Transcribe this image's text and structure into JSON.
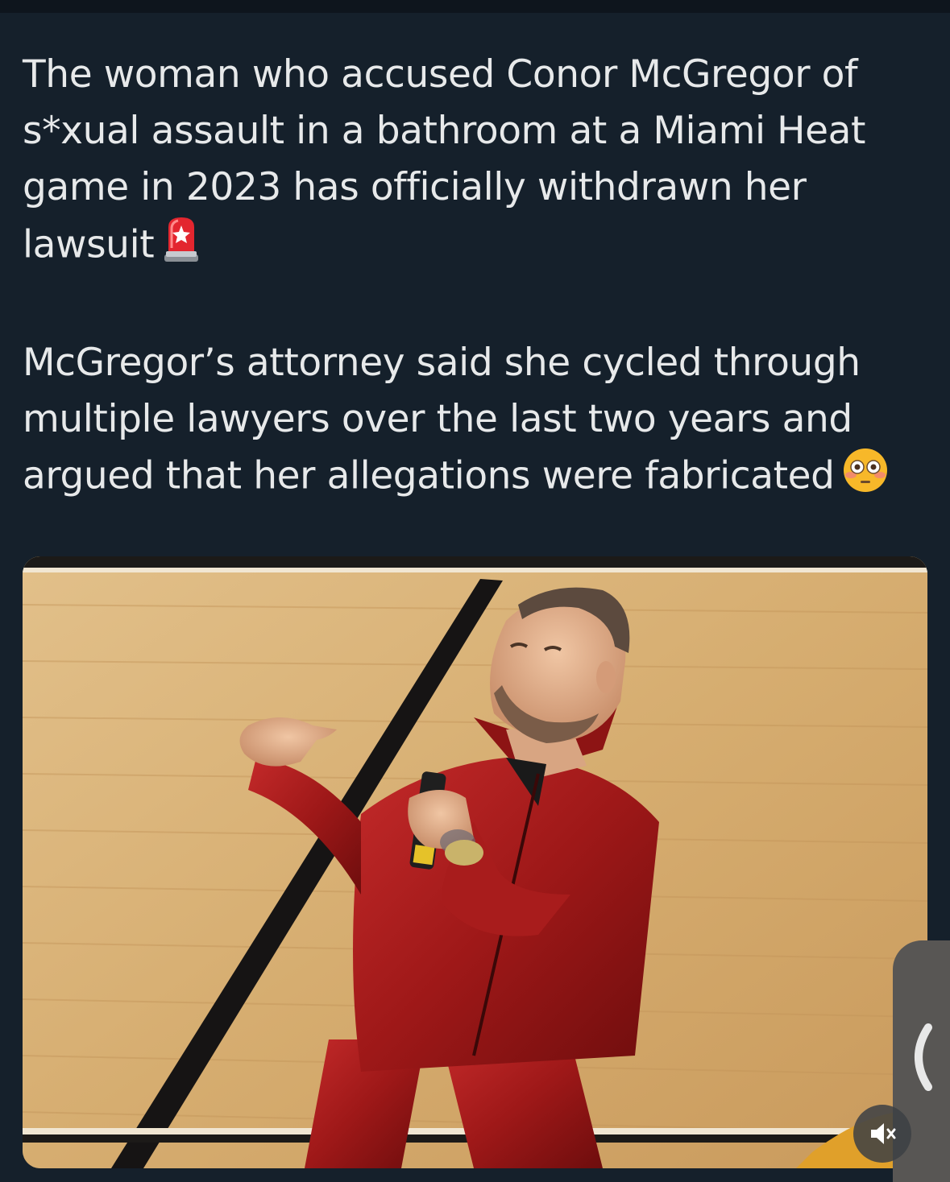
{
  "tweet": {
    "paragraph_1": "The woman who accused Conor McGregor of s*xual assault in a bathroom at a Miami Heat game in 2023 has officially withdrawn her lawsuit",
    "paragraph_1_emoji": "police-car-light-emoji",
    "paragraph_2": "McGregor’s attorney said she cycled through multiple lawyers over the last two years and argued that her allegations were fabricated",
    "paragraph_2_emoji": "flushed-face-emoji"
  },
  "media": {
    "type": "photo",
    "subject": "man in red velour tracksuit holding a can on a basketball court"
  },
  "controls": {
    "side_tab_icon": "chevron-left-icon",
    "mute_icon": "speaker-muted-icon"
  },
  "colors": {
    "background": "#15202b",
    "text": "#e7e9ea",
    "court": "#d4a868",
    "tracksuit": "#a31c1c"
  }
}
